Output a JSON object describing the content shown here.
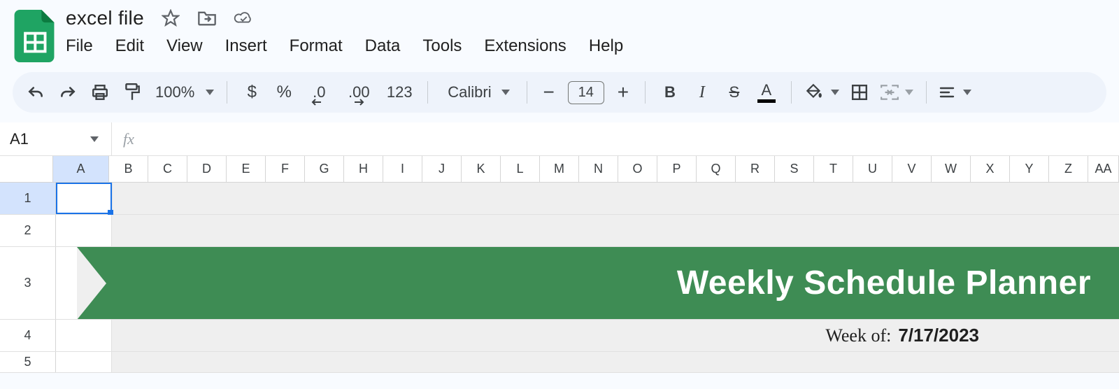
{
  "doc": {
    "title": "excel file"
  },
  "menu": {
    "file": "File",
    "edit": "Edit",
    "view": "View",
    "insert": "Insert",
    "format": "Format",
    "data": "Data",
    "tools": "Tools",
    "extensions": "Extensions",
    "help": "Help"
  },
  "toolbar": {
    "zoom": "100%",
    "currency": "$",
    "percent": "%",
    "dec_decrease": ".0",
    "dec_increase": ".00",
    "number_format": "123",
    "font_name": "Calibri",
    "font_size": "14",
    "bold": "B",
    "italic": "I",
    "strike": "S",
    "text_color": "A"
  },
  "namebox": {
    "ref": "A1"
  },
  "formula": {
    "fx": "fx"
  },
  "columns": [
    "A",
    "B",
    "C",
    "D",
    "E",
    "F",
    "G",
    "H",
    "I",
    "J",
    "K",
    "L",
    "M",
    "N",
    "O",
    "P",
    "Q",
    "R",
    "S",
    "T",
    "U",
    "V",
    "W",
    "X",
    "Y",
    "Z",
    "AA"
  ],
  "rows": [
    "1",
    "2",
    "3",
    "4",
    "5"
  ],
  "sheet": {
    "banner_title": "Weekly Schedule Planner",
    "weekof_label": "Week of:",
    "weekof_date": "7/17/2023"
  }
}
